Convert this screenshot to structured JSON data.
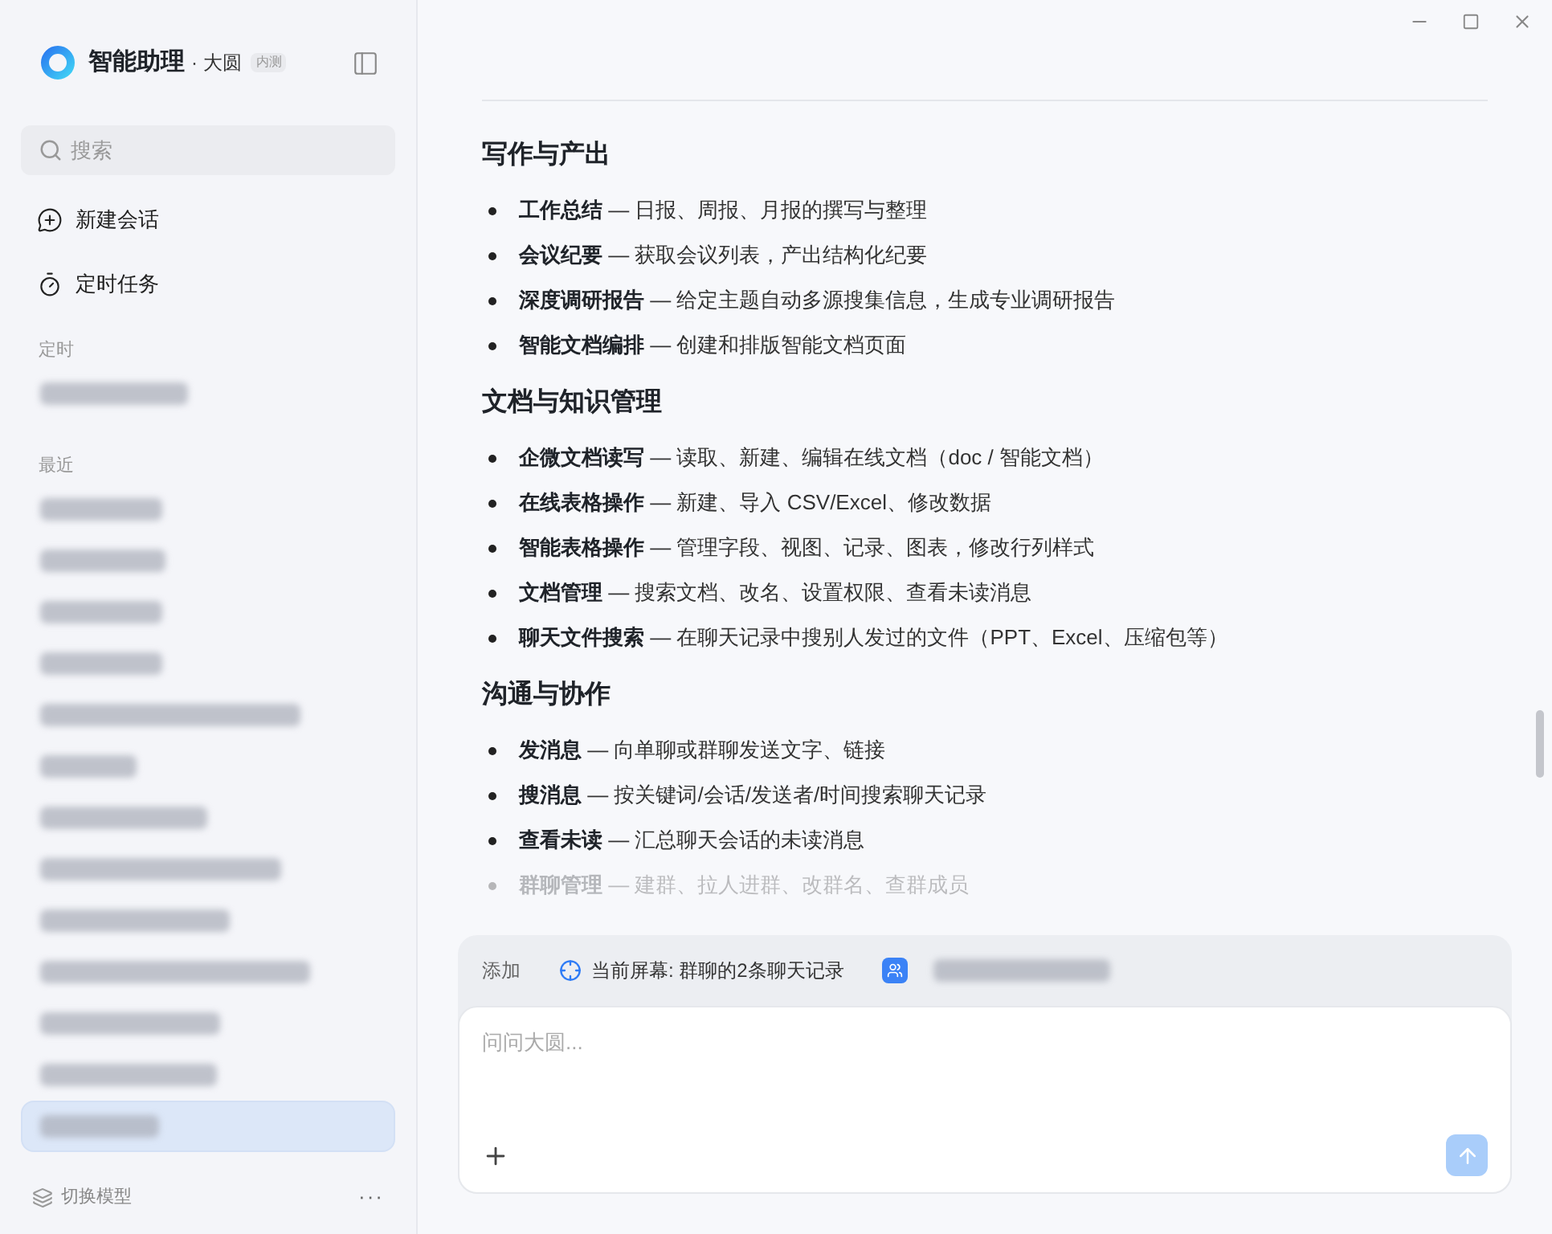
{
  "app": {
    "title": "智能助理",
    "workspace": "· 大圆",
    "badge": "内测"
  },
  "search": {
    "placeholder": "搜索"
  },
  "nav": [
    {
      "kind": "new-chat",
      "label": "新建会话"
    },
    {
      "kind": "schedule",
      "label": "定时任务"
    }
  ],
  "history": [
    {
      "heading": "定时",
      "items": [
        {
          "selected": false
        }
      ]
    },
    {
      "heading": "最近",
      "items": [
        {
          "selected": false
        },
        {
          "selected": false
        },
        {
          "selected": false
        },
        {
          "selected": false
        },
        {
          "selected": false
        },
        {
          "selected": false
        },
        {
          "selected": false
        },
        {
          "selected": false
        },
        {
          "selected": false
        },
        {
          "selected": false
        },
        {
          "selected": false
        },
        {
          "selected": false
        },
        {
          "selected": true
        }
      ]
    }
  ],
  "footer": {
    "model_label": "切换模型",
    "more": "···"
  },
  "sections": [
    {
      "heading": "写作与产出",
      "bullets": [
        {
          "text": "**工作总结** — 日报、周报、月报的撰写与整理",
          "faded": false
        },
        {
          "text": "**会议纪要** — 获取会议列表，产出结构化纪要",
          "faded": false
        },
        {
          "text": "**深度调研报告** — 给定主题自动多源搜集信息，生成专业调研报告",
          "faded": false
        },
        {
          "text": "**智能文档编排** — 创建和排版智能文档页面",
          "faded": false
        }
      ]
    },
    {
      "heading": "文档与知识管理",
      "bullets": [
        {
          "text": "**企微文档读写** — 读取、新建、编辑在线文档（doc / 智能文档）",
          "faded": false
        },
        {
          "text": "**在线表格操作** — 新建、导入 CSV/Excel、修改数据",
          "faded": false
        },
        {
          "text": "**智能表格操作** — 管理字段、视图、记录、图表，修改行列样式",
          "faded": false
        },
        {
          "text": "**文档管理** — 搜索文档、改名、设置权限、查看未读消息",
          "faded": false
        },
        {
          "text": "**聊天文件搜索** — 在聊天记录中搜别人发过的文件（PPT、Excel、压缩包等）",
          "faded": false
        }
      ]
    },
    {
      "heading": "沟通与协作",
      "bullets": [
        {
          "text": "**发消息** — 向单聊或群聊发送文字、链接",
          "faded": false
        },
        {
          "text": "**搜消息** — 按关键词/会话/发送者/时间搜索聊天记录",
          "faded": false
        },
        {
          "text": "**查看未读** — 汇总聊天会话的未读消息",
          "faded": false
        },
        {
          "text": "**群聊管理** — 建群、拉人进群、改群名、查群成员",
          "faded": true
        }
      ]
    }
  ],
  "composer": {
    "add_label": "添加",
    "context": "当前屏幕: 群聊的2条聊天记录",
    "placeholder": "问问大圆..."
  }
}
